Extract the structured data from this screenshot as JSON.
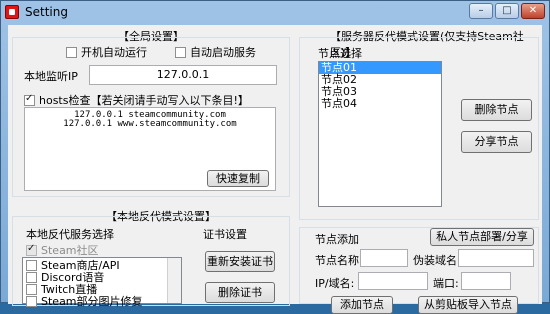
{
  "window": {
    "title": "Setting",
    "controls": {
      "minimize": "–",
      "maximize": "□",
      "close": "✕"
    }
  },
  "global": {
    "section_title": "【全局设置】",
    "autostart_label": "开机自动运行",
    "autoservice_label": "自动启动服务",
    "listen_ip_label": "本地监听IP",
    "listen_ip_value": "127.0.0.1",
    "hosts_check_label": "hosts检查【若关闭请手动写入以下条目!】",
    "hosts_lines": [
      "127.0.0.1 steamcommunity.com",
      "127.0.0.1 www.steamcommunity.com"
    ],
    "quick_copy_label": "快速复制"
  },
  "local_proxy": {
    "section_title": "【本地反代模式设置】",
    "service_select_label": "本地反代服务选择",
    "steam_community_label": "Steam社区",
    "services": [
      "Steam商店/API",
      "Discord语音",
      "Twitch直播",
      "Steam部分图片修复"
    ],
    "cert_label": "证书设置",
    "reinstall_cert_label": "重新安装证书",
    "delete_cert_label": "删除证书"
  },
  "server_proxy": {
    "section_title": "【服务器反代模式设置(仅支持Steam社区)】",
    "node_select_label": "节点选择",
    "nodes": [
      "节点01",
      "节点02",
      "节点03",
      "节点04"
    ],
    "selected_node_index": 0,
    "delete_node_label": "删除节点",
    "share_node_label": "分享节点",
    "node_add_label": "节点添加",
    "private_deploy_label": "私人节点部署/分享",
    "node_name_label": "节点名称:",
    "node_name_value": "",
    "fake_domain_label": "伪装域名:",
    "fake_domain_value": "",
    "ip_domain_label": "IP/域名:",
    "ip_domain_value": "",
    "port_label": "端口:",
    "port_value": "",
    "add_node_label": "添加节点",
    "import_node_label": "从剪贴板导入节点"
  }
}
